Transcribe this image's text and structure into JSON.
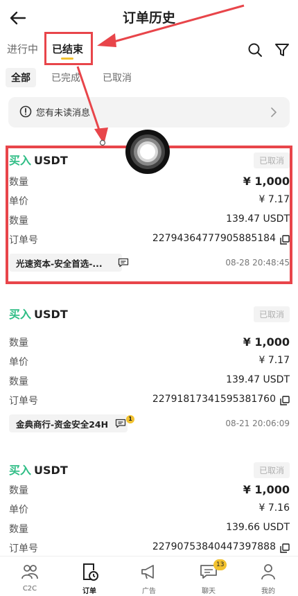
{
  "header": {
    "title": "订单历史"
  },
  "tabs": [
    {
      "label": "进行中"
    },
    {
      "label": "已结束"
    }
  ],
  "subtabs": [
    {
      "label": "全部"
    },
    {
      "label": "已完成"
    },
    {
      "label": "已取消"
    }
  ],
  "notice": {
    "text": "您有未读消息"
  },
  "orders": [
    {
      "side": "买入",
      "coin": "USDT",
      "status": "已取消",
      "qty_label": "数量",
      "amount": "¥ 1,000",
      "price_label": "单价",
      "price": "¥ 7.17",
      "qty2_label": "数量",
      "quantity": "139.47 USDT",
      "id_label": "订单号",
      "order_id": "22794364777905885184",
      "merchant": "光速资本-安全首选-...",
      "time": "08-28 20:48:45"
    },
    {
      "side": "买入",
      "coin": "USDT",
      "status": "已取消",
      "qty_label": "数量",
      "amount": "¥ 1,000",
      "price_label": "单价",
      "price": "¥ 7.17",
      "qty2_label": "数量",
      "quantity": "139.47 USDT",
      "id_label": "订单号",
      "order_id": "22791817341595381760",
      "merchant": "金典商行-资金安全24H",
      "merchant_badge": "1",
      "time": "08-21 20:06:09"
    },
    {
      "side": "买入",
      "coin": "USDT",
      "status": "已取消",
      "qty_label": "数量",
      "amount": "¥ 1,000",
      "price_label": "单价",
      "price": "¥ 7.16",
      "qty2_label": "数量",
      "quantity": "139.66 USDT",
      "id_label": "订单号",
      "order_id": "22790753840447397888"
    }
  ],
  "tabbar": [
    {
      "label": "C2C",
      "icon": "users-icon"
    },
    {
      "label": "订单",
      "icon": "order-clock-icon"
    },
    {
      "label": "广告",
      "icon": "megaphone-icon"
    },
    {
      "label": "聊天",
      "icon": "chat-icon",
      "badge": "13"
    },
    {
      "label": "我的",
      "icon": "person-icon"
    }
  ],
  "colors": {
    "accent": "#f2c230",
    "buy": "#2ebd85",
    "highlight": "#e8454a"
  }
}
